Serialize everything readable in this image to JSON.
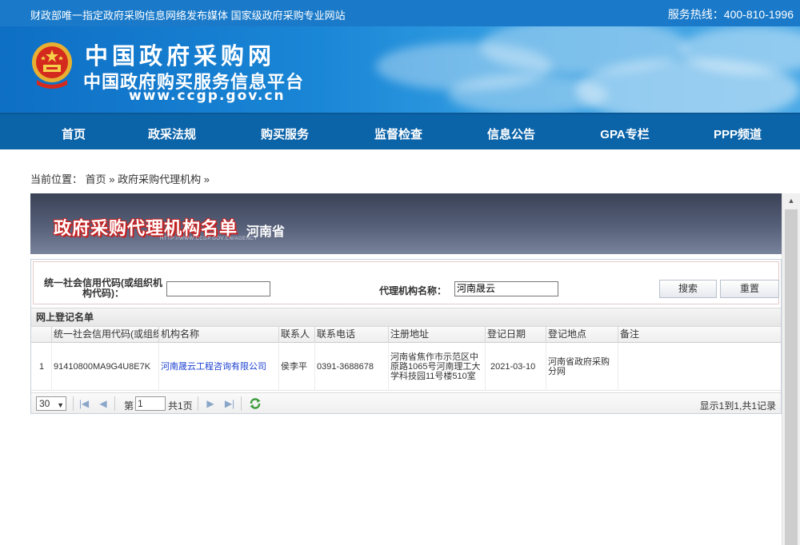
{
  "topbar": {
    "tagline": "财政部唯一指定政府采购信息网络发布媒体 国家级政府采购专业网站",
    "hotline": "服务热线：400-810-1996"
  },
  "banner": {
    "logo_cn": "中国政府采购网",
    "logo_cn2": "中国政府购买服务信息平台",
    "logo_url": "www.ccgp.gov.cn"
  },
  "nav": {
    "items": [
      "首页",
      "政采法规",
      "购买服务",
      "监督检查",
      "信息公告",
      "GPA专栏",
      "PPP频道"
    ]
  },
  "breadcrumb": {
    "prefix": "当前位置：",
    "home": "首页",
    "sep1": "»",
    "current": "政府采购代理机构",
    "sep2": "»"
  },
  "title_panel": {
    "main": "政府采购代理机构名单",
    "province": "河南省",
    "sub_url": "HTTP://WWW.CCGP.GOV.CN/AGENCY"
  },
  "search": {
    "credit_code_label": "统一社会信用代码(或组织机构代码)：",
    "credit_code_value": "",
    "agency_name_label": "代理机构名称：",
    "agency_name_value": "河南晟云",
    "search_button": "搜索",
    "reset_button": "重置"
  },
  "grid": {
    "title": "网上登记名单",
    "columns": [
      "统一社会信用代码(或组织",
      "机构名称",
      "联系人",
      "联系电话",
      "注册地址",
      "登记日期",
      "登记地点",
      "备注"
    ],
    "rows": [
      {
        "index": "1",
        "credit_code": "91410800MA9G4U8E7K",
        "name": "河南晟云工程咨询有限公司",
        "contact": "侯李平",
        "phone": "0391-3688678",
        "address": "河南省焦作市示范区中原路1065号河南理工大学科技园11号楼510室",
        "date": "2021-03-10",
        "place": "河南省政府采购分网",
        "remark": ""
      }
    ]
  },
  "pager": {
    "page_size": "30",
    "page_prefix": "第",
    "page_value": "1",
    "page_suffix": "共1页",
    "info": "显示1到1,共1记录"
  }
}
